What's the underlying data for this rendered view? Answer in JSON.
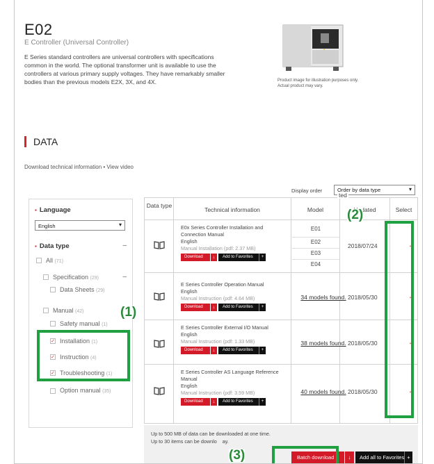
{
  "product": {
    "title": "E02",
    "subtitle": "E Controller (Universal Controller)",
    "description": "E Series standard controllers are universal controllers with specifications common in the world. The optional transformer unit is available to use the controllers at various primary supply voltages. They have remarkably smaller bodies than the previous models E2X, 3X, and 4X.",
    "image_note_1": "Product image for illustration purposes only.",
    "image_note_2": "Actual product may vary."
  },
  "data_section": {
    "heading": "DATA",
    "links": "Download technical information • View video",
    "display_order_label": "Display order",
    "display_order_value": "Order by data type"
  },
  "filters": {
    "language_label": "Language",
    "language_value": "English",
    "datatype_label": "Data type",
    "collapse_symbol": "–",
    "all_label": "All",
    "all_count": "(71)",
    "items": [
      {
        "label": "Specification",
        "count": "(29)"
      },
      {
        "label": "Data Sheets",
        "count": "(29)"
      },
      {
        "label": "Manual",
        "count": "(42)"
      },
      {
        "label": "Safety manual",
        "count": "(1)"
      },
      {
        "label": "Installation",
        "count": "(1)"
      },
      {
        "label": "Instruction",
        "count": "(4)"
      },
      {
        "label": "Troubleshooting",
        "count": "(1)"
      },
      {
        "label": "Option manual",
        "count": "(35)"
      }
    ]
  },
  "table": {
    "headers": {
      "data_type": "Data type",
      "tech_info": "Technical information",
      "model": "Model",
      "updated": "Updated",
      "select": "Select"
    },
    "download_label": "Download",
    "favorites_label": "Add to Favorites",
    "rows": [
      {
        "title": "E0x Series Controller Installation and Connection Manual",
        "language": "English",
        "manual": "Manual Installation (pdf: 2.37 MB)",
        "models": [
          "E01",
          "E02",
          "E03",
          "E04"
        ],
        "date": "2018/07/24"
      },
      {
        "title": "E Series Controller Operation Manual",
        "language": "English",
        "manual": "Manual Instruction (pdf: 4.64 MB)",
        "models_link": "34 models found.",
        "date": "2018/05/30"
      },
      {
        "title": "E Series Controller External I/O Manual",
        "language": "English",
        "manual": "Manual Instruction (pdf: 1.33 MB)",
        "models_link": "38 models found.",
        "date": "2018/05/30"
      },
      {
        "title": "E Series Controller AS Language Reference Manual",
        "language": "English",
        "manual": "Manual Instruction (pdf: 3.59 MB)",
        "models_link": "40 models found.",
        "date": "2018/05/30"
      }
    ]
  },
  "bottom": {
    "note1": "Up to 500 MB of data can be downloaded at one time.",
    "note2": "Up to 30 items can be downlo",
    "note2_tail": "ay.",
    "batch_label": "Batch download",
    "all_fav_label": "Add all to Favorites"
  },
  "callouts": {
    "c1": "(1)",
    "c2": "(2)",
    "c3": "(3)"
  },
  "colors": {
    "accent_red": "#d31a28",
    "highlight_green": "#20a040"
  }
}
